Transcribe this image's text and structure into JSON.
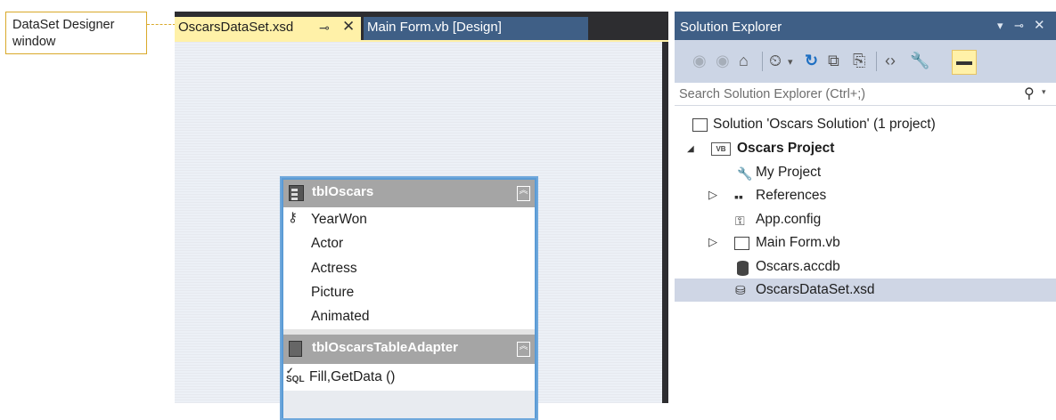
{
  "callout": {
    "text": "DataSet Designer window"
  },
  "designer": {
    "active_tab": "OscarsDataSet.xsd",
    "inactive_tab": "Main Form.vb [Design]",
    "table": {
      "name": "tblOscars",
      "columns": [
        "YearWon",
        "Actor",
        "Actress",
        "Picture",
        "Animated"
      ],
      "adapter_name": "tblOscarsTableAdapter",
      "adapter_method": "Fill,GetData ()"
    }
  },
  "solution_explorer": {
    "title": "Solution Explorer",
    "search_placeholder": "Search Solution Explorer (Ctrl+;)",
    "tree": {
      "solution": "Solution 'Oscars Solution' (1 project)",
      "project": "Oscars Project",
      "my_project": "My Project",
      "references": "References",
      "app_config": "App.config",
      "main_form": "Main Form.vb",
      "accdb": "Oscars.accdb",
      "dataset": "OscarsDataSet.xsd"
    }
  },
  "colors": {
    "active_tab": "#fff1a8",
    "vs_blue": "#3f5f86",
    "callout_border": "#d9a92a",
    "table_border": "#5b9bd5",
    "selected_row": "#cfd6e5"
  }
}
